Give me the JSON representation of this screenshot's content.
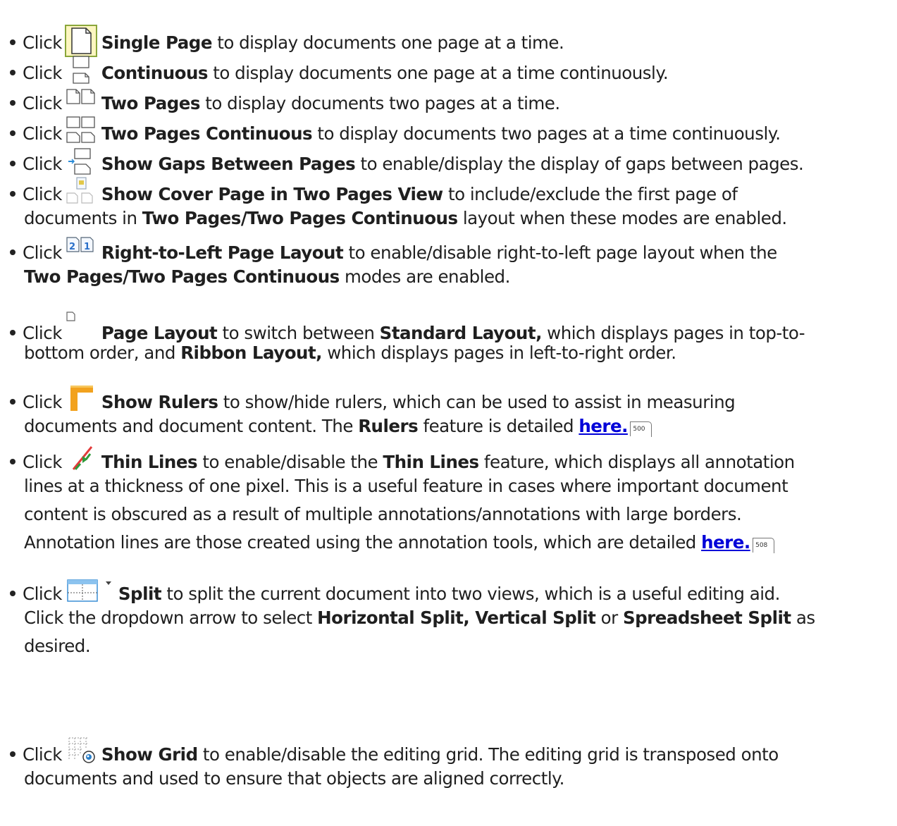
{
  "click_word": "Click",
  "items": [
    {
      "icon": "single-page-icon",
      "name": "Single Page",
      "text": " to display documents one page at a time."
    },
    {
      "icon": "continuous-icon",
      "name": "Continuous",
      "text": " to display documents one page at a time continuously."
    },
    {
      "icon": "two-pages-icon",
      "name": "Two Pages",
      "text": " to display documents two pages at a time."
    },
    {
      "icon": "two-pages-continuous-icon",
      "name": "Two Pages Continuous",
      "text": " to display documents two pages at a time continuously."
    },
    {
      "icon": "show-gaps-icon",
      "name": "Show Gaps Between Pages",
      "text": " to enable/display the display of gaps between pages."
    },
    {
      "icon": "cover-page-icon",
      "name": "Show Cover Page in Two Pages View",
      "text": " to include/exclude the first page of",
      "l2a": "documents in ",
      "l2b": "Two Pages/Two Pages Continuous",
      "l2c": " layout when these modes are enabled."
    },
    {
      "icon": "right-to-left-icon",
      "name": "Right-to-Left Page Layout",
      "text": " to enable/disable right-to-left page layout when the",
      "l2b": "Two Pages/Two Pages Continuous",
      "l2c": " modes are enabled."
    },
    {
      "icon": "page-layout-icon",
      "name": "Page Layout",
      "text": " to switch between ",
      "b2": "Standard Layout,",
      "t2": " which displays pages in top-to-",
      "l2a": "bottom order, and ",
      "l2b": "Ribbon Layout,",
      "l2c": " which displays pages in left-to-right order."
    },
    {
      "icon": "rulers-icon",
      "name": "Show Rulers",
      "text": " to show/hide rulers, which can be used to assist in measuring",
      "l2a": "documents and document content. The ",
      "l2b": "Rulers",
      "l2c": " feature is detailed ",
      "link": "here.",
      "pageref": "500"
    },
    {
      "icon": "thin-lines-icon",
      "name": "Thin Lines",
      "text": " to enable/disable the ",
      "b2": "Thin Lines",
      "t2": " feature, which displays all annotation",
      "l2": "lines at a thickness of one pixel. This is a useful feature in cases where important document",
      "l3": "content is obscured as a result of multiple annotations/annotations with large borders.",
      "l4": "Annotation lines are those created using the annotation tools, which are detailed ",
      "link": "here.",
      "pageref": "508"
    },
    {
      "icon": "split-icon",
      "name": "Split",
      "text": " to split the current document into two views, which is a useful editing aid.",
      "l2a": "Click the dropdown arrow to select ",
      "l2b": "Horizontal Split, Vertical Split",
      "l2c": " or ",
      "l2d": "Spreadsheet Split",
      "l2e": " as",
      "l3": "desired."
    },
    {
      "icon": "show-grid-icon",
      "name": "Show Grid",
      "text": " to enable/disable the editing grid. The editing grid is transposed onto",
      "l2": "documents and used to ensure that objects are aligned correctly."
    }
  ]
}
